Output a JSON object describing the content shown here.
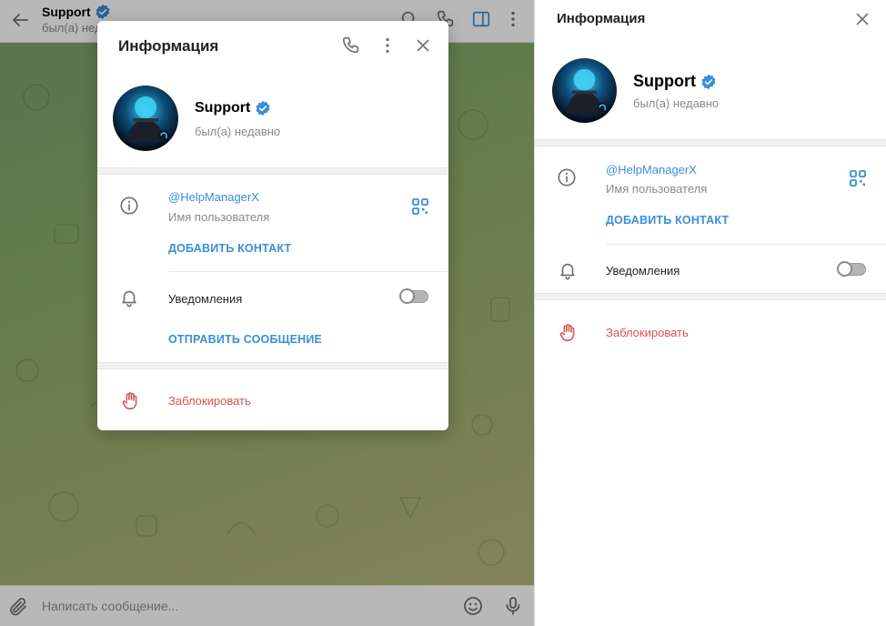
{
  "chat": {
    "title": "Support",
    "status": "был(а) недавно",
    "composer_placeholder": "Написать сообщение..."
  },
  "side_panel": {
    "title": "Информация",
    "name": "Support",
    "status": "был(а) недавно",
    "username": "@HelpManagerX",
    "username_label": "Имя пользователя",
    "add_contact": "ДОБАВИТЬ КОНТАКТ",
    "notifications": "Уведомления",
    "notifications_enabled": false,
    "block": "Заблокировать"
  },
  "modal": {
    "title": "Информация",
    "name": "Support",
    "status": "был(а) недавно",
    "username": "@HelpManagerX",
    "username_label": "Имя пользователя",
    "add_contact": "ДОБАВИТЬ КОНТАКТ",
    "notifications": "Уведомления",
    "notifications_enabled": false,
    "send_message": "ОТПРАВИТЬ СООБЩЕНИЕ",
    "block": "Заблокировать"
  },
  "colors": {
    "accent": "#3a8fd6",
    "danger": "#d8534f",
    "verified": "#3a8fd6"
  }
}
